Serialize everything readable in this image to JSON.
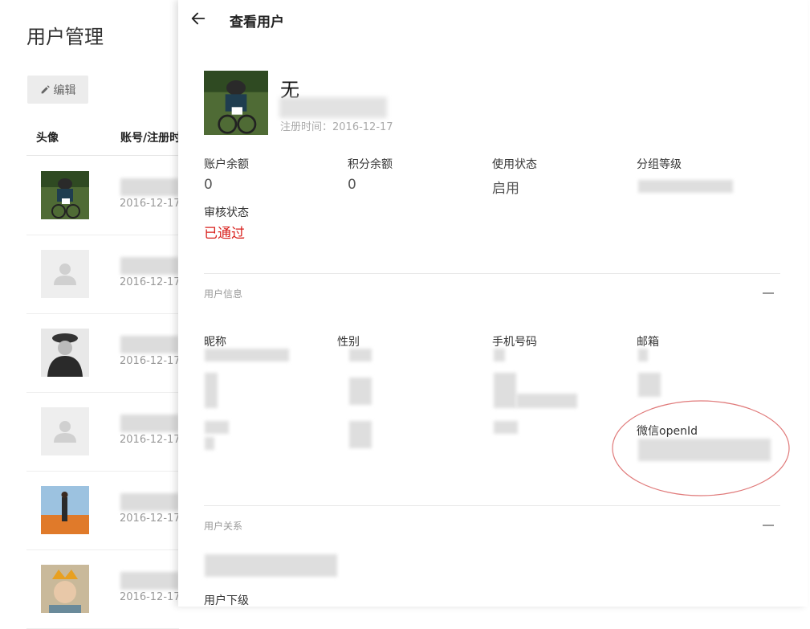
{
  "list_page": {
    "title": "用户管理",
    "edit_button": "编辑",
    "columns": {
      "avatar": "头像",
      "account": "账号/注册时"
    },
    "rows": [
      {
        "avatar": "cyclist-photo",
        "date": "2016-12-17"
      },
      {
        "avatar": "default-avatar",
        "date": "2016-12-17"
      },
      {
        "avatar": "officer-photo",
        "date": "2016-12-17"
      },
      {
        "avatar": "default-avatar",
        "date": "2016-12-17"
      },
      {
        "avatar": "desert-photo",
        "date": "2016-12-17"
      },
      {
        "avatar": "child-photo",
        "date": "2016-12-17"
      }
    ]
  },
  "drawer": {
    "title": "查看用户",
    "user": {
      "name": "无",
      "registered": "注册时间：2016-12-17"
    },
    "stats": {
      "balance_label": "账户余额",
      "balance_value": "0",
      "points_label": "积分余额",
      "points_value": "0",
      "status_label": "使用状态",
      "status_value": "启用",
      "group_label": "分组等级",
      "review_label": "审核状态",
      "review_value": "已通过"
    },
    "user_info": {
      "title": "用户信息",
      "fields": {
        "nickname": "昵称",
        "gender": "性别",
        "phone": "手机号码",
        "email": "邮箱",
        "openid": "微信openId"
      }
    },
    "relations": {
      "title": "用户关系",
      "subordinate_label": "用户下级"
    }
  },
  "colors": {
    "review_ok": "#d8201c",
    "annotation": "#e07a7a"
  }
}
